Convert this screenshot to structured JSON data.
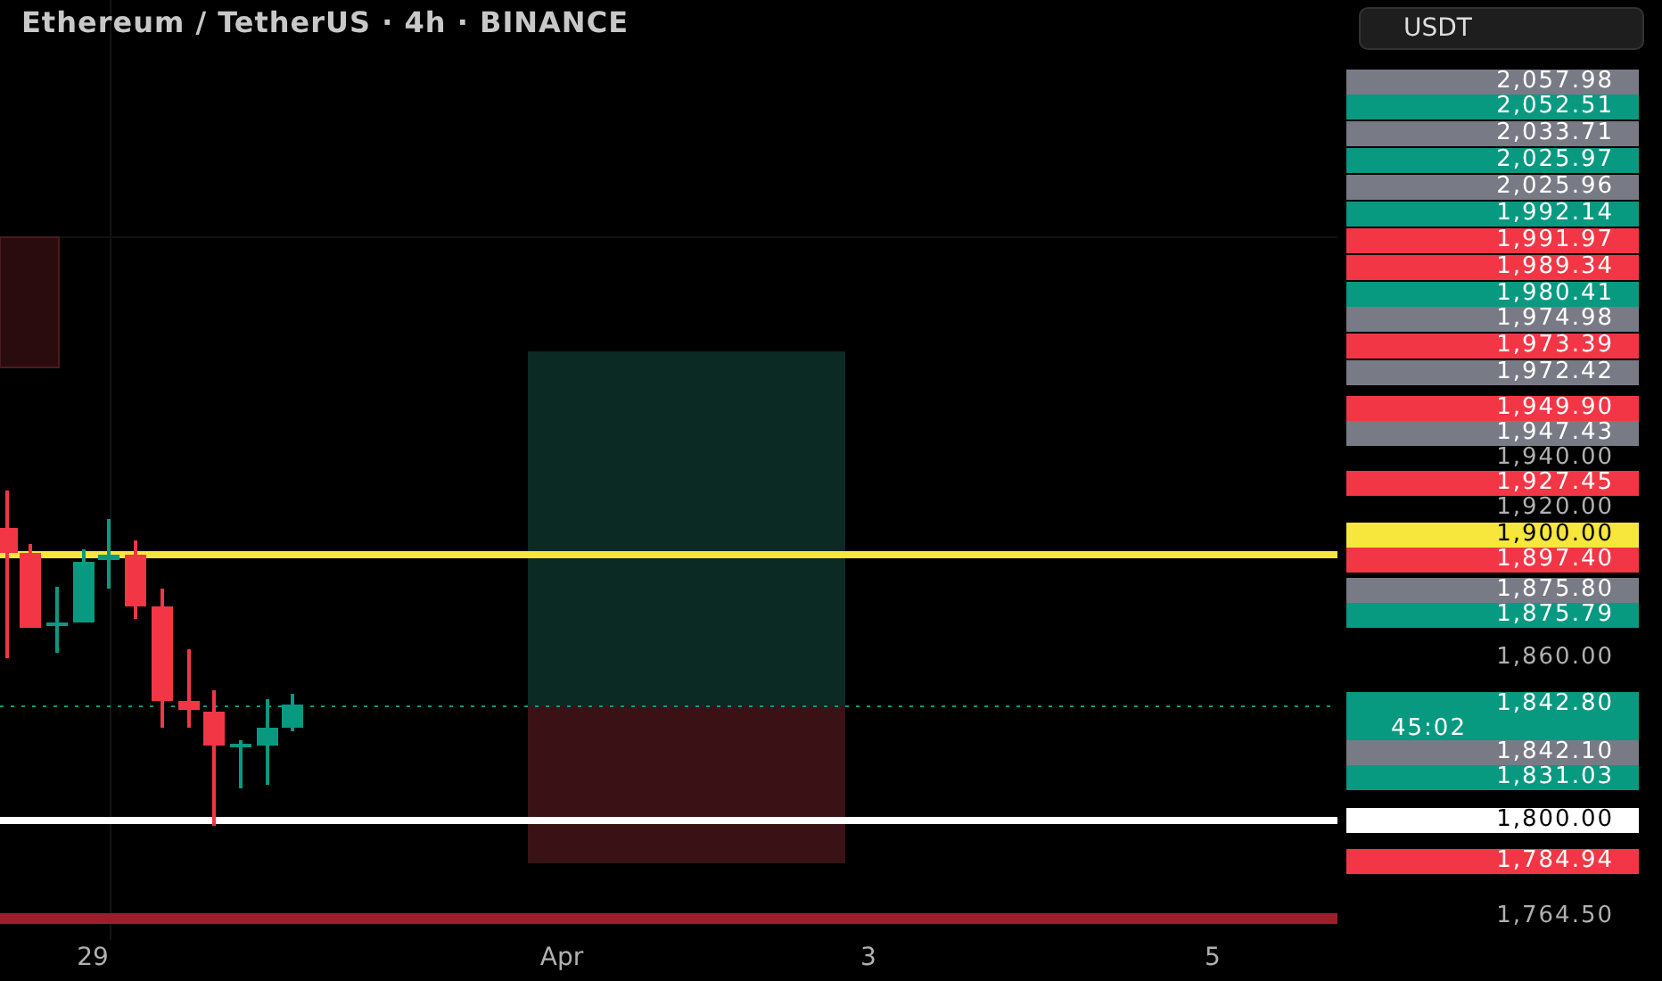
{
  "title": "Ethereum / TetherUS · 4h · BINANCE",
  "currency_button": "USDT",
  "price_axis": [
    {
      "text": "2,057.98",
      "kind": "tag",
      "color": "#787b86"
    },
    {
      "text": "2,052.51",
      "kind": "tag",
      "color": "#089981"
    },
    {
      "text": "2,033.71",
      "kind": "tag",
      "color": "#787b86"
    },
    {
      "text": "2,025.97",
      "kind": "tag",
      "color": "#089981"
    },
    {
      "text": "2,025.96",
      "kind": "tag",
      "color": "#787b86"
    },
    {
      "text": "1,992.14",
      "kind": "tag",
      "color": "#089981"
    },
    {
      "text": "1,991.97",
      "kind": "tag",
      "color": "#f23645"
    },
    {
      "text": "1,989.34",
      "kind": "tag",
      "color": "#f23645"
    },
    {
      "text": "1,980.41",
      "kind": "tag",
      "color": "#089981"
    },
    {
      "text": "1,974.98",
      "kind": "tag",
      "color": "#787b86"
    },
    {
      "text": "1,973.39",
      "kind": "tag",
      "color": "#f23645"
    },
    {
      "text": "1,972.42",
      "kind": "tag",
      "color": "#787b86"
    },
    {
      "text": "1,949.90",
      "kind": "tag",
      "color": "#f23645"
    },
    {
      "text": "1,947.43",
      "kind": "tag",
      "color": "#787b86"
    },
    {
      "text": "1,940.00",
      "kind": "plain"
    },
    {
      "text": "1,927.45",
      "kind": "tag",
      "color": "#f23645"
    },
    {
      "text": "1,920.00",
      "kind": "plain"
    },
    {
      "text": "1,900.00",
      "kind": "tag",
      "color": "#f7e63b"
    },
    {
      "text": "1,897.40",
      "kind": "tag",
      "color": "#f23645"
    },
    {
      "text": "1,875.80",
      "kind": "tag",
      "color": "#787b86"
    },
    {
      "text": "1,875.79",
      "kind": "tag",
      "color": "#089981"
    },
    {
      "text": "1,860.00",
      "kind": "plain"
    },
    {
      "text": "1,842.80",
      "kind": "tag",
      "color": "#089981",
      "countdown": "45:02"
    },
    {
      "text": "1,842.10",
      "kind": "tag",
      "color": "#787b86"
    },
    {
      "text": "1,831.03",
      "kind": "tag",
      "color": "#089981"
    },
    {
      "text": "1,800.00",
      "kind": "tag",
      "color": "#ffffff"
    },
    {
      "text": "1,784.94",
      "kind": "tag",
      "color": "#f23645"
    },
    {
      "text": "1,764.50",
      "kind": "plain"
    }
  ],
  "time_axis": [
    "29",
    "Apr",
    "3",
    "5"
  ]
}
